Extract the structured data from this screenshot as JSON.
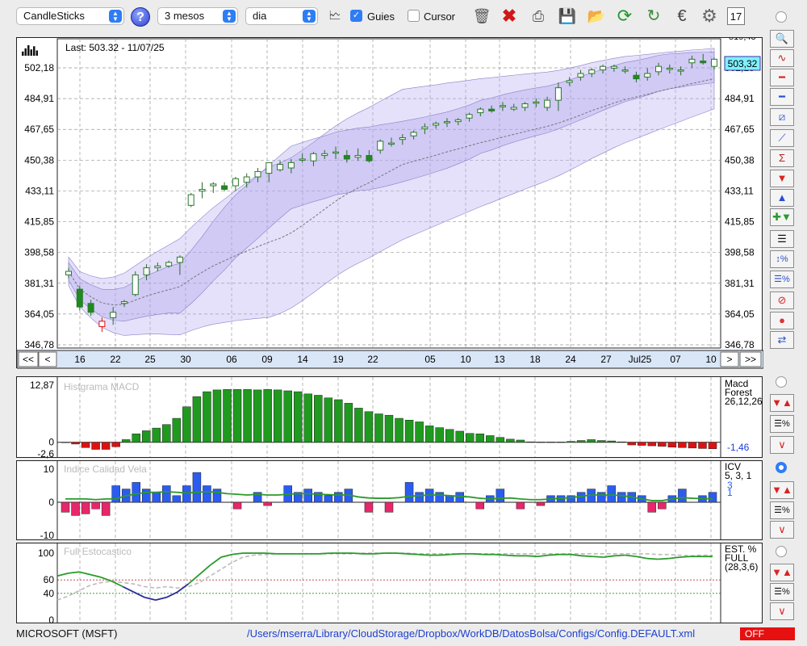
{
  "toolbar": {
    "chart_type": "CandleSticks",
    "period": "3 mesos",
    "interval": "dia",
    "guies_label": "Guies",
    "guies_checked": true,
    "cursor_label": "Cursor",
    "cursor_checked": false,
    "icons": [
      "trash-icon",
      "delete-icon",
      "print-icon",
      "save-icon",
      "open-folder-icon",
      "refresh-icon",
      "update-icon",
      "currency-icon",
      "settings-icon",
      "calendar-icon"
    ]
  },
  "main_chart": {
    "last_label": "Last: 503.32 - 11/07/25",
    "last_value_badge": "503,32",
    "nav_first": "<<",
    "nav_prev": "<",
    "nav_next": ">",
    "nav_last": ">>",
    "top_partial_label": "519,43"
  },
  "macd": {
    "title": "Histgrama MACD",
    "name": "Macd",
    "sub": "Forest",
    "params": "26,12,26",
    "value": "-1,46"
  },
  "icv": {
    "title": "Indice Calidad Vela",
    "name": "ICV",
    "params": "5, 3, 1",
    "v1": "3",
    "v2": "1"
  },
  "est": {
    "title": "Full Estocastico",
    "name": "EST. %",
    "sub": "FULL",
    "params": "(28,3,6)"
  },
  "status": {
    "symbol": "MICROSOFT (MSFT)",
    "path": "/Users/mserra/Library/CloudStorage/Dropbox/WorkDB/DatosBolsa/Configs/Config.DEFAULT.xml",
    "off": "OFF"
  },
  "chart_data": [
    {
      "type": "candlestick",
      "title": "",
      "ylim": [
        346.78,
        519.43
      ],
      "yticks": [
        "502,18",
        "484,91",
        "467,65",
        "450,38",
        "433,11",
        "415,85",
        "398,58",
        "381,31",
        "364,05",
        "346,78"
      ],
      "xticks": [
        "16",
        "22",
        "25",
        "30",
        "06",
        "09",
        "14",
        "19",
        "22",
        "05",
        "10",
        "13",
        "18",
        "24",
        "27",
        "Jul25",
        "07",
        "10"
      ],
      "ohlc": [
        [
          386,
          390,
          384,
          388
        ],
        [
          378,
          380,
          366,
          368
        ],
        [
          370,
          372,
          363,
          365
        ],
        [
          357,
          362,
          354,
          360
        ],
        [
          362,
          368,
          358,
          365
        ],
        [
          370,
          372,
          368,
          371
        ],
        [
          375,
          388,
          374,
          386
        ],
        [
          386,
          392,
          383,
          390
        ],
        [
          390,
          393,
          388,
          391
        ],
        [
          391,
          394,
          390,
          393
        ],
        [
          393,
          397,
          386,
          396
        ],
        [
          425,
          432,
          424,
          431
        ],
        [
          433,
          438,
          429,
          434
        ],
        [
          436,
          438,
          432,
          437
        ],
        [
          436,
          438,
          433,
          434
        ],
        [
          436,
          441,
          433,
          440
        ],
        [
          438,
          443,
          435,
          441
        ],
        [
          441,
          446,
          438,
          444
        ],
        [
          443,
          447,
          438,
          449
        ],
        [
          445,
          450,
          444,
          448
        ],
        [
          446,
          451,
          443,
          449
        ],
        [
          451,
          454,
          449,
          451
        ],
        [
          450,
          455,
          447,
          454
        ],
        [
          453,
          456,
          451,
          454
        ],
        [
          455,
          458,
          451,
          455
        ],
        [
          453,
          456,
          449,
          451
        ],
        [
          452,
          457,
          450,
          453
        ],
        [
          453,
          456,
          449,
          450
        ],
        [
          456,
          462,
          454,
          461
        ],
        [
          460,
          463,
          458,
          460
        ],
        [
          462,
          465,
          459,
          463
        ],
        [
          464,
          467,
          462,
          466
        ],
        [
          468,
          471,
          465,
          469
        ],
        [
          470,
          472,
          468,
          471
        ],
        [
          472,
          474,
          469,
          472
        ],
        [
          472,
          474,
          470,
          473
        ],
        [
          474,
          477,
          472,
          476
        ],
        [
          477,
          480,
          475,
          479
        ],
        [
          479,
          481,
          477,
          478
        ],
        [
          481,
          483,
          478,
          481
        ],
        [
          479,
          482,
          478,
          480
        ],
        [
          480,
          483,
          478,
          482
        ],
        [
          483,
          485,
          480,
          483
        ],
        [
          480,
          486,
          478,
          484
        ],
        [
          484,
          494,
          478,
          491
        ],
        [
          494,
          497,
          492,
          495
        ],
        [
          497,
          501,
          495,
          499
        ],
        [
          499,
          502,
          497,
          501
        ],
        [
          501,
          504,
          499,
          503
        ],
        [
          502,
          504,
          500,
          503
        ],
        [
          501,
          503,
          499,
          501
        ],
        [
          498,
          500,
          494,
          496
        ],
        [
          497,
          502,
          495,
          499
        ],
        [
          500,
          505,
          498,
          503
        ],
        [
          502,
          504,
          499,
          502
        ],
        [
          501,
          503,
          498,
          501
        ],
        [
          505,
          509,
          502,
          507
        ],
        [
          506,
          510,
          504,
          505
        ],
        [
          503,
          508,
          501,
          507
        ]
      ]
    },
    {
      "type": "bar",
      "title": "Histgrama MACD",
      "ylim": [
        -2.6,
        12.87
      ],
      "yticks": [
        "12,87",
        "0",
        "-2,6"
      ],
      "values": [
        0,
        -0.4,
        -1.2,
        -1.6,
        -1.6,
        -1.0,
        0.6,
        1.9,
        2.6,
        3.2,
        4.0,
        5.4,
        8.0,
        10.3,
        11.4,
        11.8,
        11.9,
        11.9,
        11.9,
        11.8,
        11.9,
        11.8,
        11.6,
        11.4,
        10.9,
        10.6,
        10.0,
        9.6,
        8.8,
        7.7,
        6.9,
        6.4,
        6.1,
        5.4,
        5.0,
        4.6,
        3.7,
        3.3,
        2.9,
        2.5,
        2.0,
        1.9,
        1.5,
        1.1,
        0.7,
        0.5,
        0.1,
        0.05,
        0.05,
        0.05,
        0.2,
        0.4,
        0.6,
        0.4,
        0.3,
        0.1,
        -0.6,
        -0.7,
        -0.8,
        -0.9,
        -1.1,
        -1.2,
        -1.3,
        -1.4,
        -1.46
      ]
    },
    {
      "type": "bar",
      "title": "Indice Calidad Vela",
      "ylim": [
        -10,
        10
      ],
      "yticks": [
        "10",
        "0",
        "-10"
      ],
      "values": [
        -3,
        -4,
        -3.5,
        -2,
        -4,
        5,
        4,
        6,
        4,
        3,
        5,
        2,
        5,
        9,
        5,
        4,
        0,
        -2,
        0,
        3,
        -1,
        0,
        5,
        3,
        4,
        3,
        2,
        3,
        4,
        0,
        -3,
        0,
        -3,
        0,
        6,
        3,
        4,
        3,
        2,
        3,
        0,
        -2,
        2,
        4,
        0,
        -2,
        0,
        -1,
        2,
        2,
        2,
        3,
        4,
        3,
        5,
        3,
        3,
        2,
        -3,
        -2,
        2,
        4,
        0,
        2,
        3
      ],
      "line": [
        1,
        1,
        1,
        0.8,
        1,
        1,
        2,
        2.5,
        3,
        3,
        3.2,
        3,
        2.8,
        3,
        3.2,
        3,
        2.6,
        2.4,
        2.2,
        2.4,
        2.2,
        2.2,
        2.4,
        2.6,
        2.6,
        2.4,
        2.3,
        2.2,
        2.2,
        1.6,
        1.3,
        1.2,
        1.2,
        1.4,
        1.8,
        2,
        2.2,
        2.2,
        2,
        1.8,
        1.6,
        1.2,
        1,
        1.2,
        1.3,
        1,
        0.8,
        0.8,
        1,
        1.2,
        1.4,
        1.8,
        2.2,
        2.2,
        2.2,
        2,
        1.6,
        1,
        0.5,
        0.5,
        1,
        1.4,
        1.2,
        1.1,
        1
      ]
    },
    {
      "type": "line",
      "title": "Full Estocastico",
      "ylim": [
        0,
        100
      ],
      "yticks": [
        "100",
        "60",
        "40",
        "0"
      ],
      "series": [
        {
          "values": [
            66,
            70,
            72,
            68,
            64,
            58,
            50,
            42,
            34,
            30,
            34,
            42,
            54,
            68,
            82,
            94,
            98,
            100,
            100,
            100,
            99,
            99,
            99,
            99,
            99,
            100,
            100,
            100,
            99,
            99,
            100,
            100,
            99,
            98,
            97,
            97,
            98,
            99,
            99,
            98,
            98,
            97,
            96,
            96,
            95,
            97,
            98,
            98,
            96,
            95,
            94,
            96,
            97,
            95,
            92,
            91,
            92,
            94,
            95,
            95,
            95
          ]
        },
        {
          "values": [
            30,
            36,
            44,
            52,
            56,
            58,
            56,
            54,
            50,
            48,
            50,
            48,
            50,
            56,
            66,
            76,
            86,
            94,
            97,
            98,
            99,
            99,
            99,
            99,
            99,
            99,
            99,
            99,
            100,
            100,
            100,
            100,
            100,
            99,
            99,
            99,
            99,
            99,
            99,
            99,
            99,
            99,
            99,
            99,
            99,
            99,
            99,
            99,
            99,
            99,
            99,
            99,
            99,
            99,
            99,
            98,
            98,
            97,
            96,
            97,
            97
          ]
        }
      ]
    }
  ]
}
